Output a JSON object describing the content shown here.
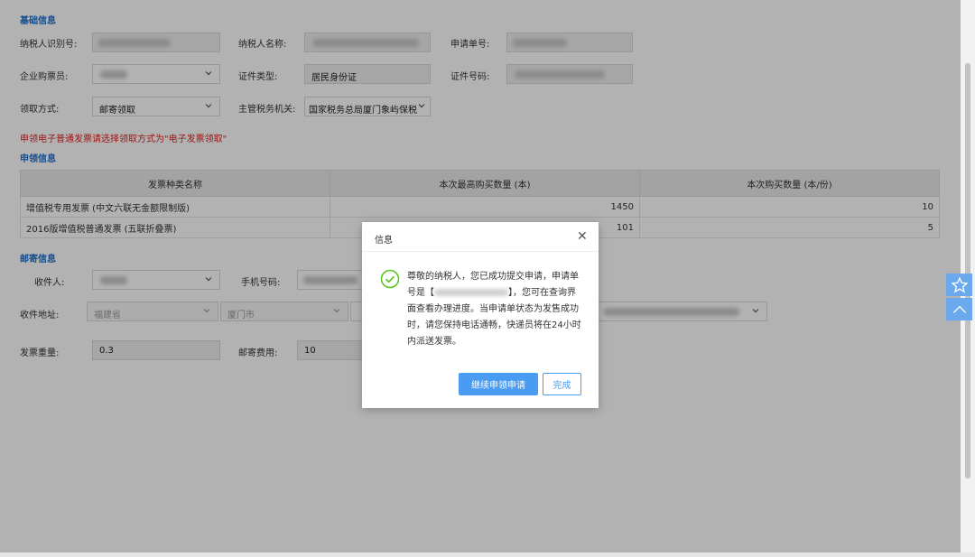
{
  "basic": {
    "title": "基础信息",
    "taxpayer_id_label": "纳税人识别号:",
    "taxpayer_name_label": "纳税人名称:",
    "application_no_label": "申请单号:",
    "buyer_label": "企业购票员:",
    "id_type_label": "证件类型:",
    "id_type_value": "居民身份证",
    "id_no_label": "证件号码:",
    "pickup_label": "领取方式:",
    "pickup_value": "邮寄领取",
    "tax_office_label": "主管税务机关:",
    "tax_office_value": "国家税务总局厦门象屿保税"
  },
  "note": "申领电子普通发票请选择领取方式为\"电子发票领取\"",
  "apply": {
    "title": "申领信息",
    "headers": [
      "发票种类名称",
      "本次最高购买数量 (本)",
      "本次购买数量 (本/份)"
    ],
    "rows": [
      [
        "增值税专用发票 (中文六联无金额限制版)",
        "1450",
        "10"
      ],
      [
        "2016版增值税普通发票 (五联折叠票)",
        "101",
        "5"
      ]
    ]
  },
  "mail": {
    "title": "邮寄信息",
    "recipient_label": "收件人:",
    "phone_label": "手机号码:",
    "address_label": "收件地址:",
    "province": "福建省",
    "city": "厦门市",
    "weight_label": "发票重量:",
    "weight_value": "0.3",
    "fee_label": "邮寄费用:",
    "fee_value": "10"
  },
  "dialog": {
    "title": "信息",
    "msg_part1": "尊敬的纳税人，您已成功提交申请，申请单号是【",
    "msg_part2": "】，您可在查询界面查看办理进度。当申请单状态为发售成功时，请您保持电话通畅，快递员将在24小时内派送发票。",
    "continue_label": "继续申领申请",
    "done_label": "完成"
  },
  "icons": {
    "success": "check-circle-icon",
    "close": "close-icon",
    "favorite": "star-icon",
    "to_top": "chevron-up-icon"
  },
  "colors": {
    "accent": "#4a9cf2",
    "section_title": "#1e6fd0",
    "note": "#e02020",
    "success": "#52c41a"
  }
}
